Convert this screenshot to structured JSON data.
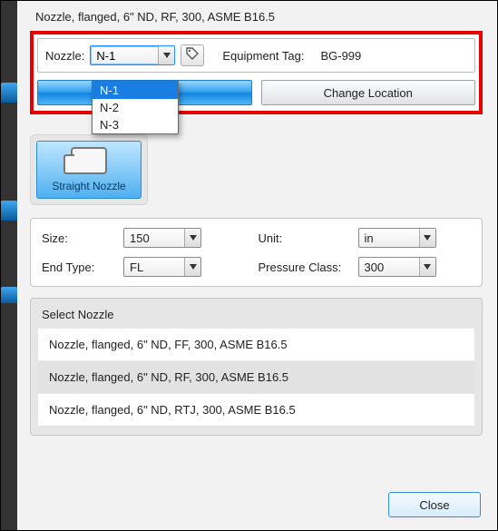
{
  "title": "Nozzle, flanged, 6\" ND, RF, 300, ASME B16.5",
  "nozzle": {
    "label": "Nozzle:",
    "selected": "N-1",
    "options": [
      "N-1",
      "N-2",
      "N-3"
    ]
  },
  "equipmentTag": {
    "label": "Equipment Tag:",
    "value": "BG-999"
  },
  "buttons": {
    "changeLocation": "Change Location",
    "close": "Close"
  },
  "typeCard": {
    "caption": "Straight Nozzle"
  },
  "props": {
    "sizeLabel": "Size:",
    "sizeValue": "150",
    "unitLabel": "Unit:",
    "unitValue": "in",
    "endTypeLabel": "End Type:",
    "endTypeValue": "FL",
    "pressureClassLabel": "Pressure Class:",
    "pressureClassValue": "300"
  },
  "selectList": {
    "header": "Select Nozzle",
    "items": [
      "Nozzle, flanged, 6\" ND, FF, 300, ASME B16.5",
      "Nozzle, flanged, 6\" ND, RF, 300, ASME B16.5",
      "Nozzle, flanged, 6\" ND, RTJ, 300, ASME B16.5"
    ]
  }
}
